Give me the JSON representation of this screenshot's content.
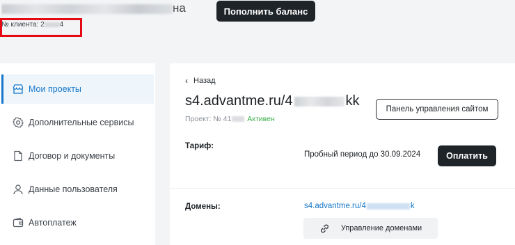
{
  "header": {
    "user_name_tail": "на",
    "client_label": "№ клиента: 2",
    "client_tail": "4",
    "topup_label": "Пополнить баланс",
    "highlight_color": "#e50914"
  },
  "sidebar": {
    "items": [
      {
        "label": "Мои проекты",
        "icon": "store-icon",
        "active": true
      },
      {
        "label": "Дополнительные сервисы",
        "icon": "gear-icon",
        "active": false
      },
      {
        "label": "Договор и документы",
        "icon": "document-icon",
        "active": false
      },
      {
        "label": "Данные пользователя",
        "icon": "user-icon",
        "active": false
      },
      {
        "label": "Автоплатеж",
        "icon": "wallet-icon",
        "active": false
      }
    ]
  },
  "project": {
    "back_label": "Назад",
    "title_prefix": "s4.advantme.ru/4",
    "title_suffix": "kk",
    "panel_button": "Панель управления сайтом",
    "meta_label": "Проект: № 41",
    "status": "Активен",
    "tariff_label": "Тариф:",
    "trial_text": "Пробный период до 30.09.2024",
    "pay_button": "Оплатить",
    "domains_label": "Домены:",
    "domain_prefix": "s4.advantme.ru/4",
    "domain_suffix": "k",
    "manage_domains_button": "Управление доменами"
  },
  "colors": {
    "accent": "#1677c9",
    "status_active": "#3bb14a",
    "dark_button": "#1f2429"
  }
}
